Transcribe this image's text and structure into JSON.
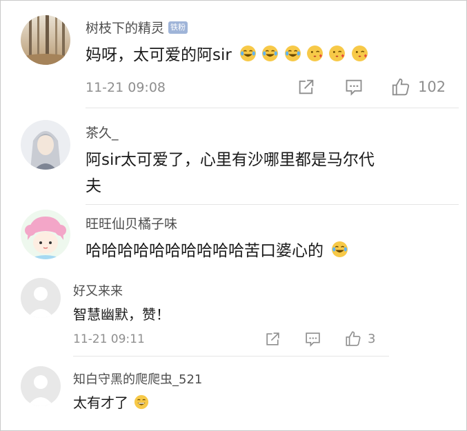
{
  "comments": [
    {
      "user": "树枝下的精灵",
      "badge": "铁粉",
      "text": "妈呀，太可爱的阿sir",
      "date": "11-21 09:08",
      "likes": "102",
      "emoji": [
        "laugh-cry-emoji",
        "laugh-cry-emoji",
        "laugh-cry-emoji",
        "kiss-emoji",
        "kiss-emoji",
        "kiss-emoji"
      ]
    },
    {
      "user": "茶久_",
      "line1": "阿sir太可爱了，心里有沙哪里都是马尔代",
      "line2": "夫"
    },
    {
      "user": "旺旺仙贝橘子味",
      "text": "哈哈哈哈哈哈哈哈哈哈苦口婆心的",
      "emoji": [
        "laugh-cry-emoji"
      ]
    },
    {
      "user": "好又来来",
      "text": "智慧幽默，赞！",
      "date": "11-21 09:11",
      "likes": "3"
    },
    {
      "user": "知白守黑的爬爬虫_521",
      "text": "太有才了",
      "emoji": [
        "grin-emoji"
      ]
    }
  ],
  "colors": {
    "badge": "#9fb4d8",
    "meta": "#8e8e8e",
    "name": "#4d4d4d",
    "emoji": "#f7c948"
  }
}
